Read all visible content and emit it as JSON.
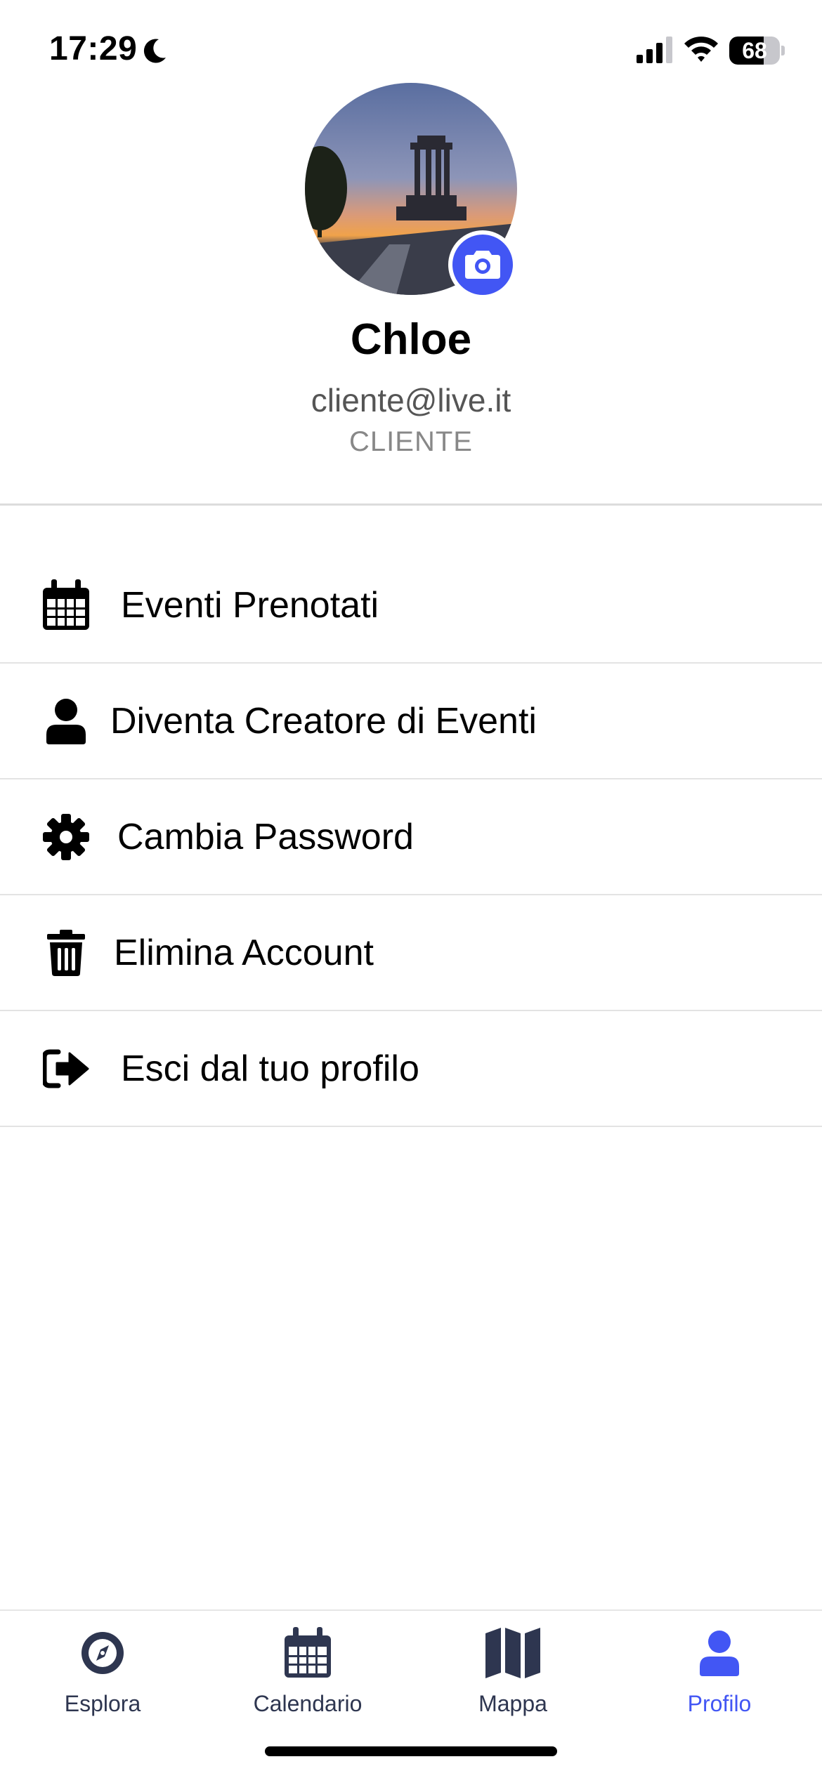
{
  "status_bar": {
    "time": "17:29",
    "battery_level": "68",
    "battery_fraction": 0.68,
    "icons": [
      "moon-icon",
      "signal-icon",
      "wifi-icon",
      "battery-icon"
    ]
  },
  "profile": {
    "name": "Chloe",
    "email": "cliente@live.it",
    "role": "CLIENTE",
    "avatar_icon": "monument-photo",
    "edit_photo_icon": "camera-icon",
    "accent_color": "#4256f4"
  },
  "menu": {
    "items": [
      {
        "label": "Eventi Prenotati",
        "icon": "calendar-icon"
      },
      {
        "label": "Diventa Creatore di Eventi",
        "icon": "user-icon"
      },
      {
        "label": "Cambia Password",
        "icon": "gear-icon"
      },
      {
        "label": "Elimina Account",
        "icon": "trash-icon"
      },
      {
        "label": "Esci dal tuo profilo",
        "icon": "logout-icon"
      }
    ]
  },
  "tab_bar": {
    "tabs": [
      {
        "label": "Esplora",
        "icon": "compass-icon",
        "active": false
      },
      {
        "label": "Calendario",
        "icon": "calendar-icon",
        "active": false
      },
      {
        "label": "Mappa",
        "icon": "map-icon",
        "active": false
      },
      {
        "label": "Profilo",
        "icon": "user-icon",
        "active": true
      }
    ],
    "active_color": "#4256f4",
    "inactive_color": "#2e3650"
  }
}
